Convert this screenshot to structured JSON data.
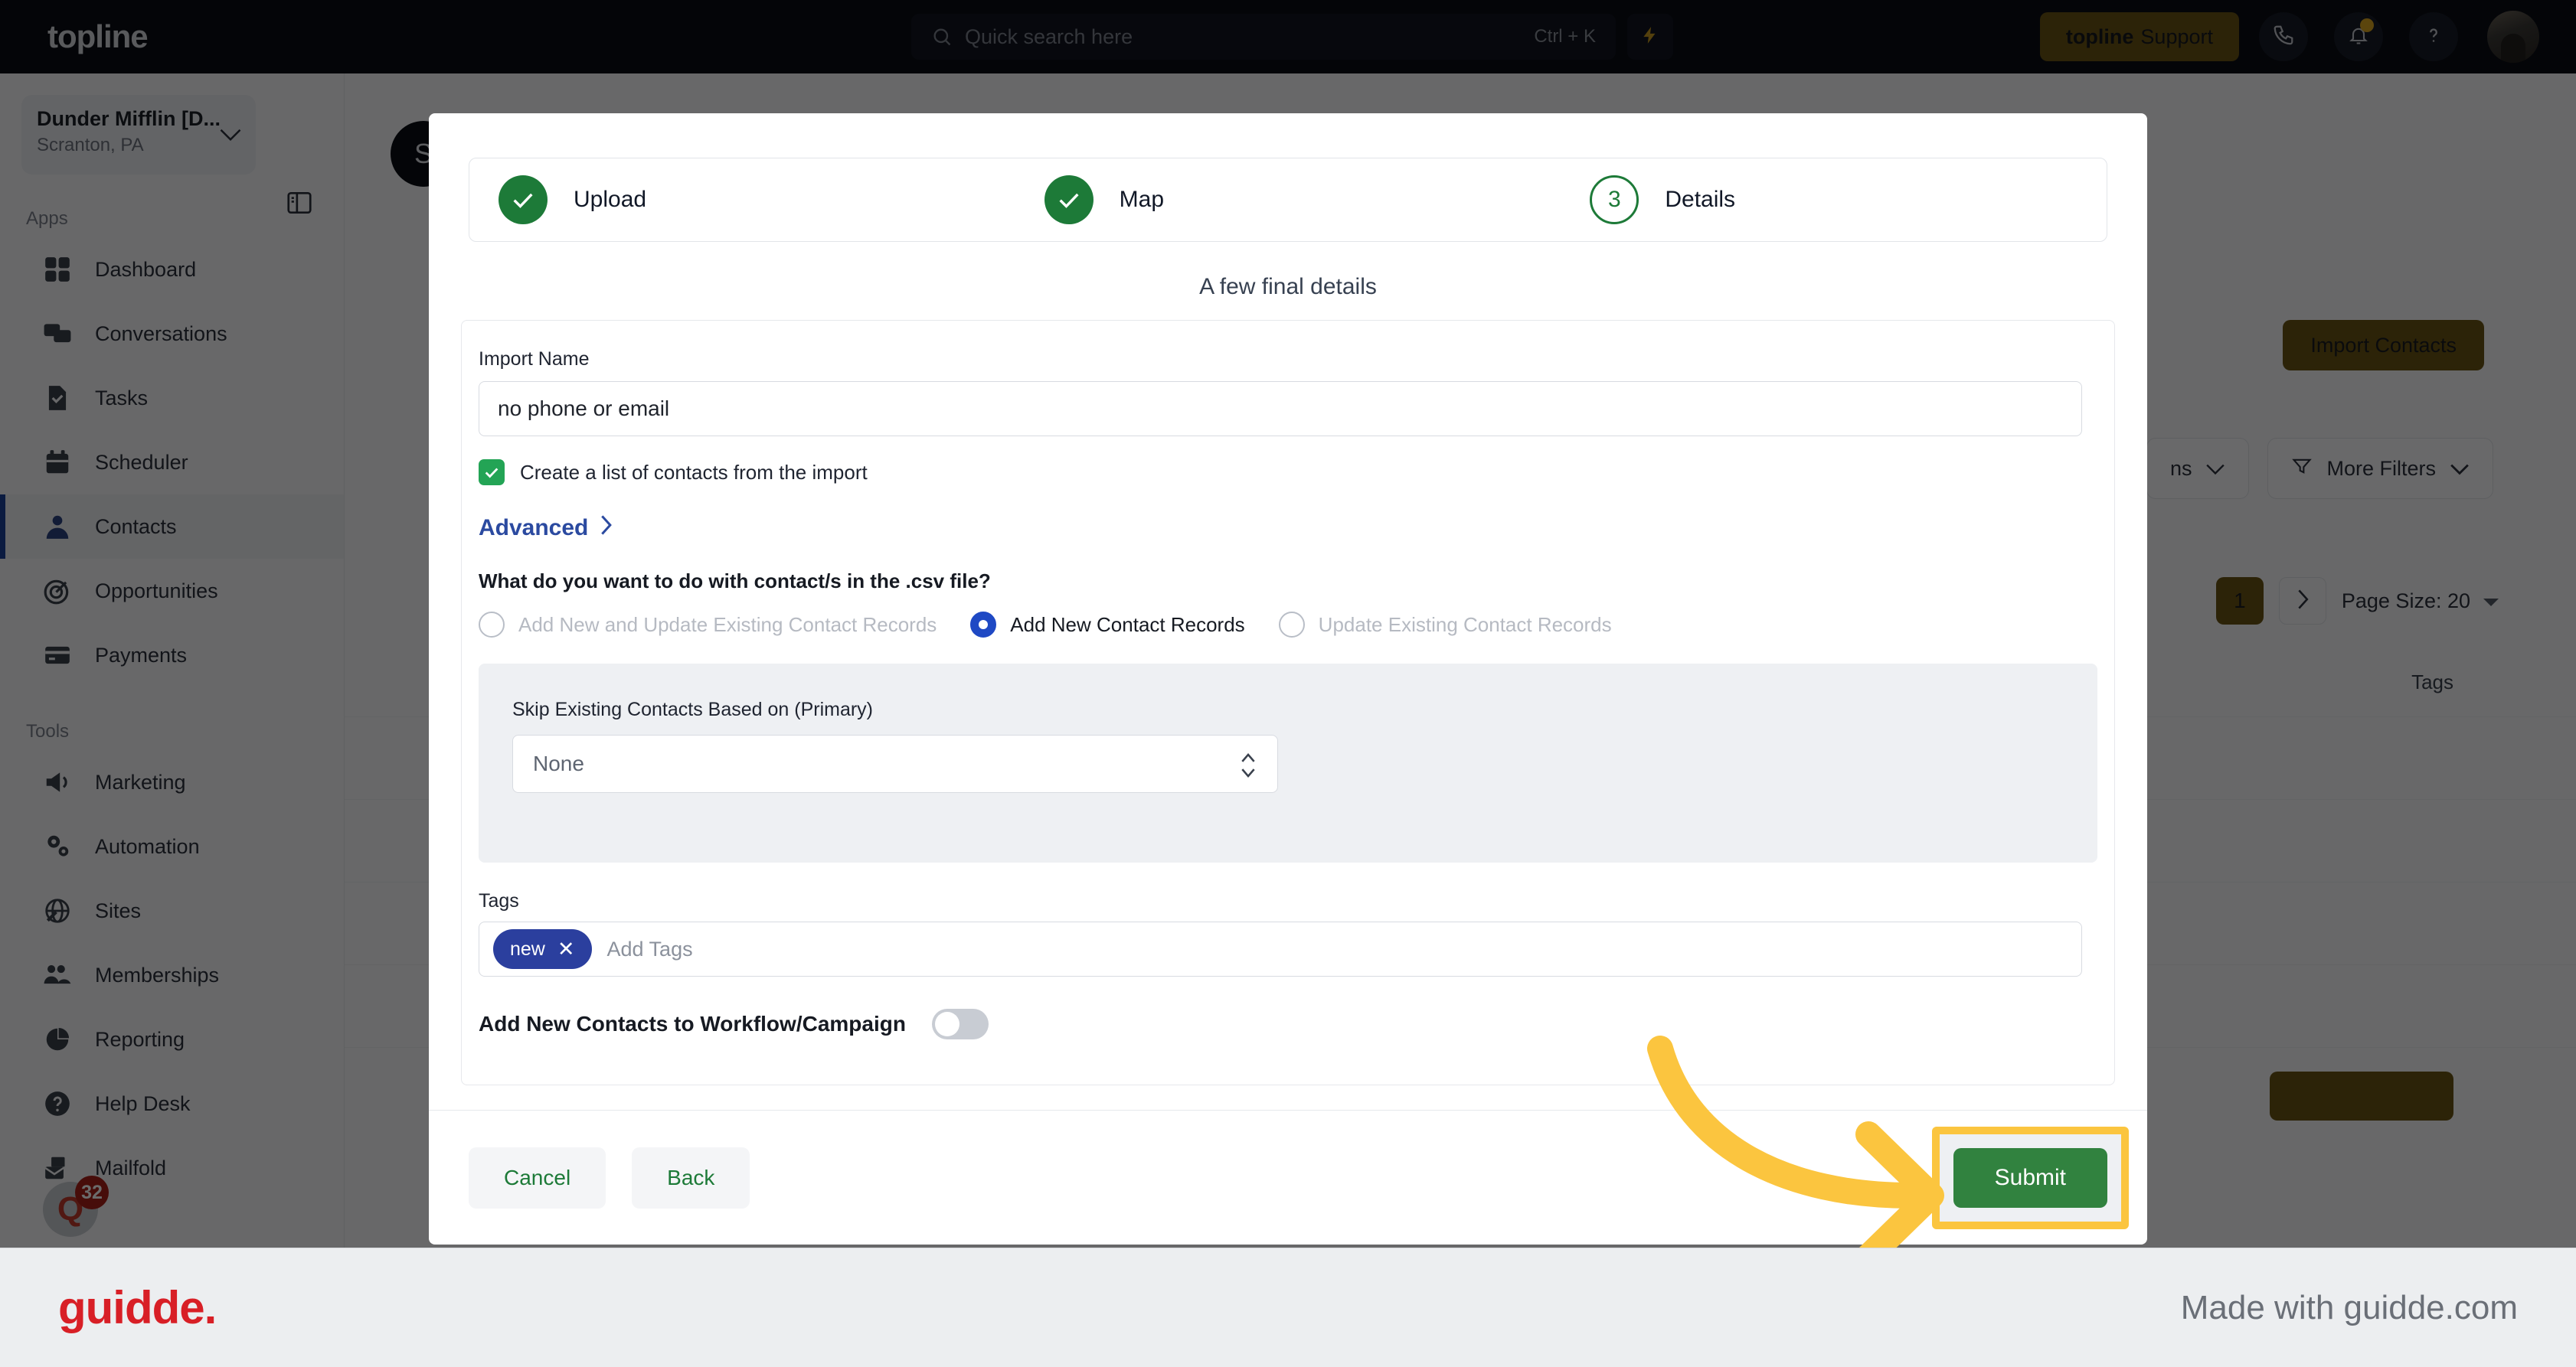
{
  "topnav": {
    "brand": "topline",
    "search": {
      "placeholder": "Quick search here",
      "shortcut": "Ctrl + K",
      "icon": "search-icon"
    },
    "bolt_icon": "lightning-bolt-icon",
    "support_logo": "topline",
    "support_label": " Support",
    "icons": {
      "phone": "phone-icon",
      "bell": "bell-icon",
      "help": "question-mark-icon",
      "avatar": "user-avatar"
    }
  },
  "sidebar": {
    "location": {
      "name": "Dunder Mifflin [D...",
      "sub": "Scranton, PA",
      "chevron": "chevron-down-icon"
    },
    "panel_toggle_icon": "panel-toggle-icon",
    "sections": [
      {
        "title": "Apps",
        "items": [
          {
            "label": "Dashboard",
            "icon": "dashboard-icon",
            "active": false
          },
          {
            "label": "Conversations",
            "icon": "conversations-icon",
            "active": false
          },
          {
            "label": "Tasks",
            "icon": "tasks-icon",
            "active": false
          },
          {
            "label": "Scheduler",
            "icon": "calendar-icon",
            "active": false
          },
          {
            "label": "Contacts",
            "icon": "contacts-icon",
            "active": true
          },
          {
            "label": "Opportunities",
            "icon": "target-icon",
            "active": false
          },
          {
            "label": "Payments",
            "icon": "credit-card-icon",
            "active": false
          }
        ]
      },
      {
        "title": "Tools",
        "items": [
          {
            "label": "Marketing",
            "icon": "megaphone-icon",
            "active": false
          },
          {
            "label": "Automation",
            "icon": "gears-icon",
            "active": false
          },
          {
            "label": "Sites",
            "icon": "globe-icon",
            "active": false
          },
          {
            "label": "Memberships",
            "icon": "people-add-icon",
            "active": false
          },
          {
            "label": "Reporting",
            "icon": "pie-chart-icon",
            "active": false
          },
          {
            "label": "Help Desk",
            "icon": "help-circle-icon",
            "active": false
          },
          {
            "label": "Mailfold",
            "icon": "mail-icon",
            "active": false
          }
        ]
      }
    ],
    "bottom": {
      "glyph": "Q",
      "badge": "32"
    }
  },
  "background": {
    "avatar_initials": "S",
    "import_contacts_label": "Import Contacts",
    "filters": [
      {
        "label": "ns",
        "icon": "chevron-down-icon"
      },
      {
        "label": "More Filters",
        "icon": "filter-icon"
      }
    ],
    "pagination": {
      "page": "1",
      "next_icon": "chevron-right-icon",
      "page_size_label": "Page Size: 20"
    },
    "column_tags": "Tags"
  },
  "modal": {
    "steps": [
      {
        "num": "1",
        "label": "Upload",
        "state": "done"
      },
      {
        "num": "2",
        "label": "Map",
        "state": "done"
      },
      {
        "num": "3",
        "label": "Details",
        "state": "current"
      }
    ],
    "subtitle": "A few final details",
    "import_name": {
      "label": "Import Name",
      "value": "no phone or email"
    },
    "create_list": {
      "label": "Create a list of contacts from the import",
      "checked": true
    },
    "advanced": {
      "label": "Advanced",
      "icon": "chevron-right-icon"
    },
    "question": "What do you want to do with contact/s in the .csv file?",
    "radios": [
      {
        "label": "Add New and Update Existing Contact Records",
        "selected": false
      },
      {
        "label": "Add New Contact Records",
        "selected": true
      },
      {
        "label": "Update Existing Contact Records",
        "selected": false
      }
    ],
    "skip_existing": {
      "label": "Skip Existing Contacts Based on (Primary)",
      "value": "None",
      "icon": "spinner-arrows-icon"
    },
    "tags": {
      "label": "Tags",
      "chips": [
        {
          "text": "new",
          "remove_icon": "close-icon"
        }
      ],
      "placeholder": "Add Tags"
    },
    "workflow": {
      "label": "Add New Contacts to Workflow/Campaign",
      "enabled": false
    },
    "footer": {
      "cancel": "Cancel",
      "back": "Back",
      "submit": "Submit"
    }
  },
  "annotation": {
    "arrow_icon": "curved-arrow-icon",
    "highlight_color": "#fbc53f"
  },
  "guidde": {
    "logo": "guidde.",
    "made_with": "Made with guidde.com"
  }
}
